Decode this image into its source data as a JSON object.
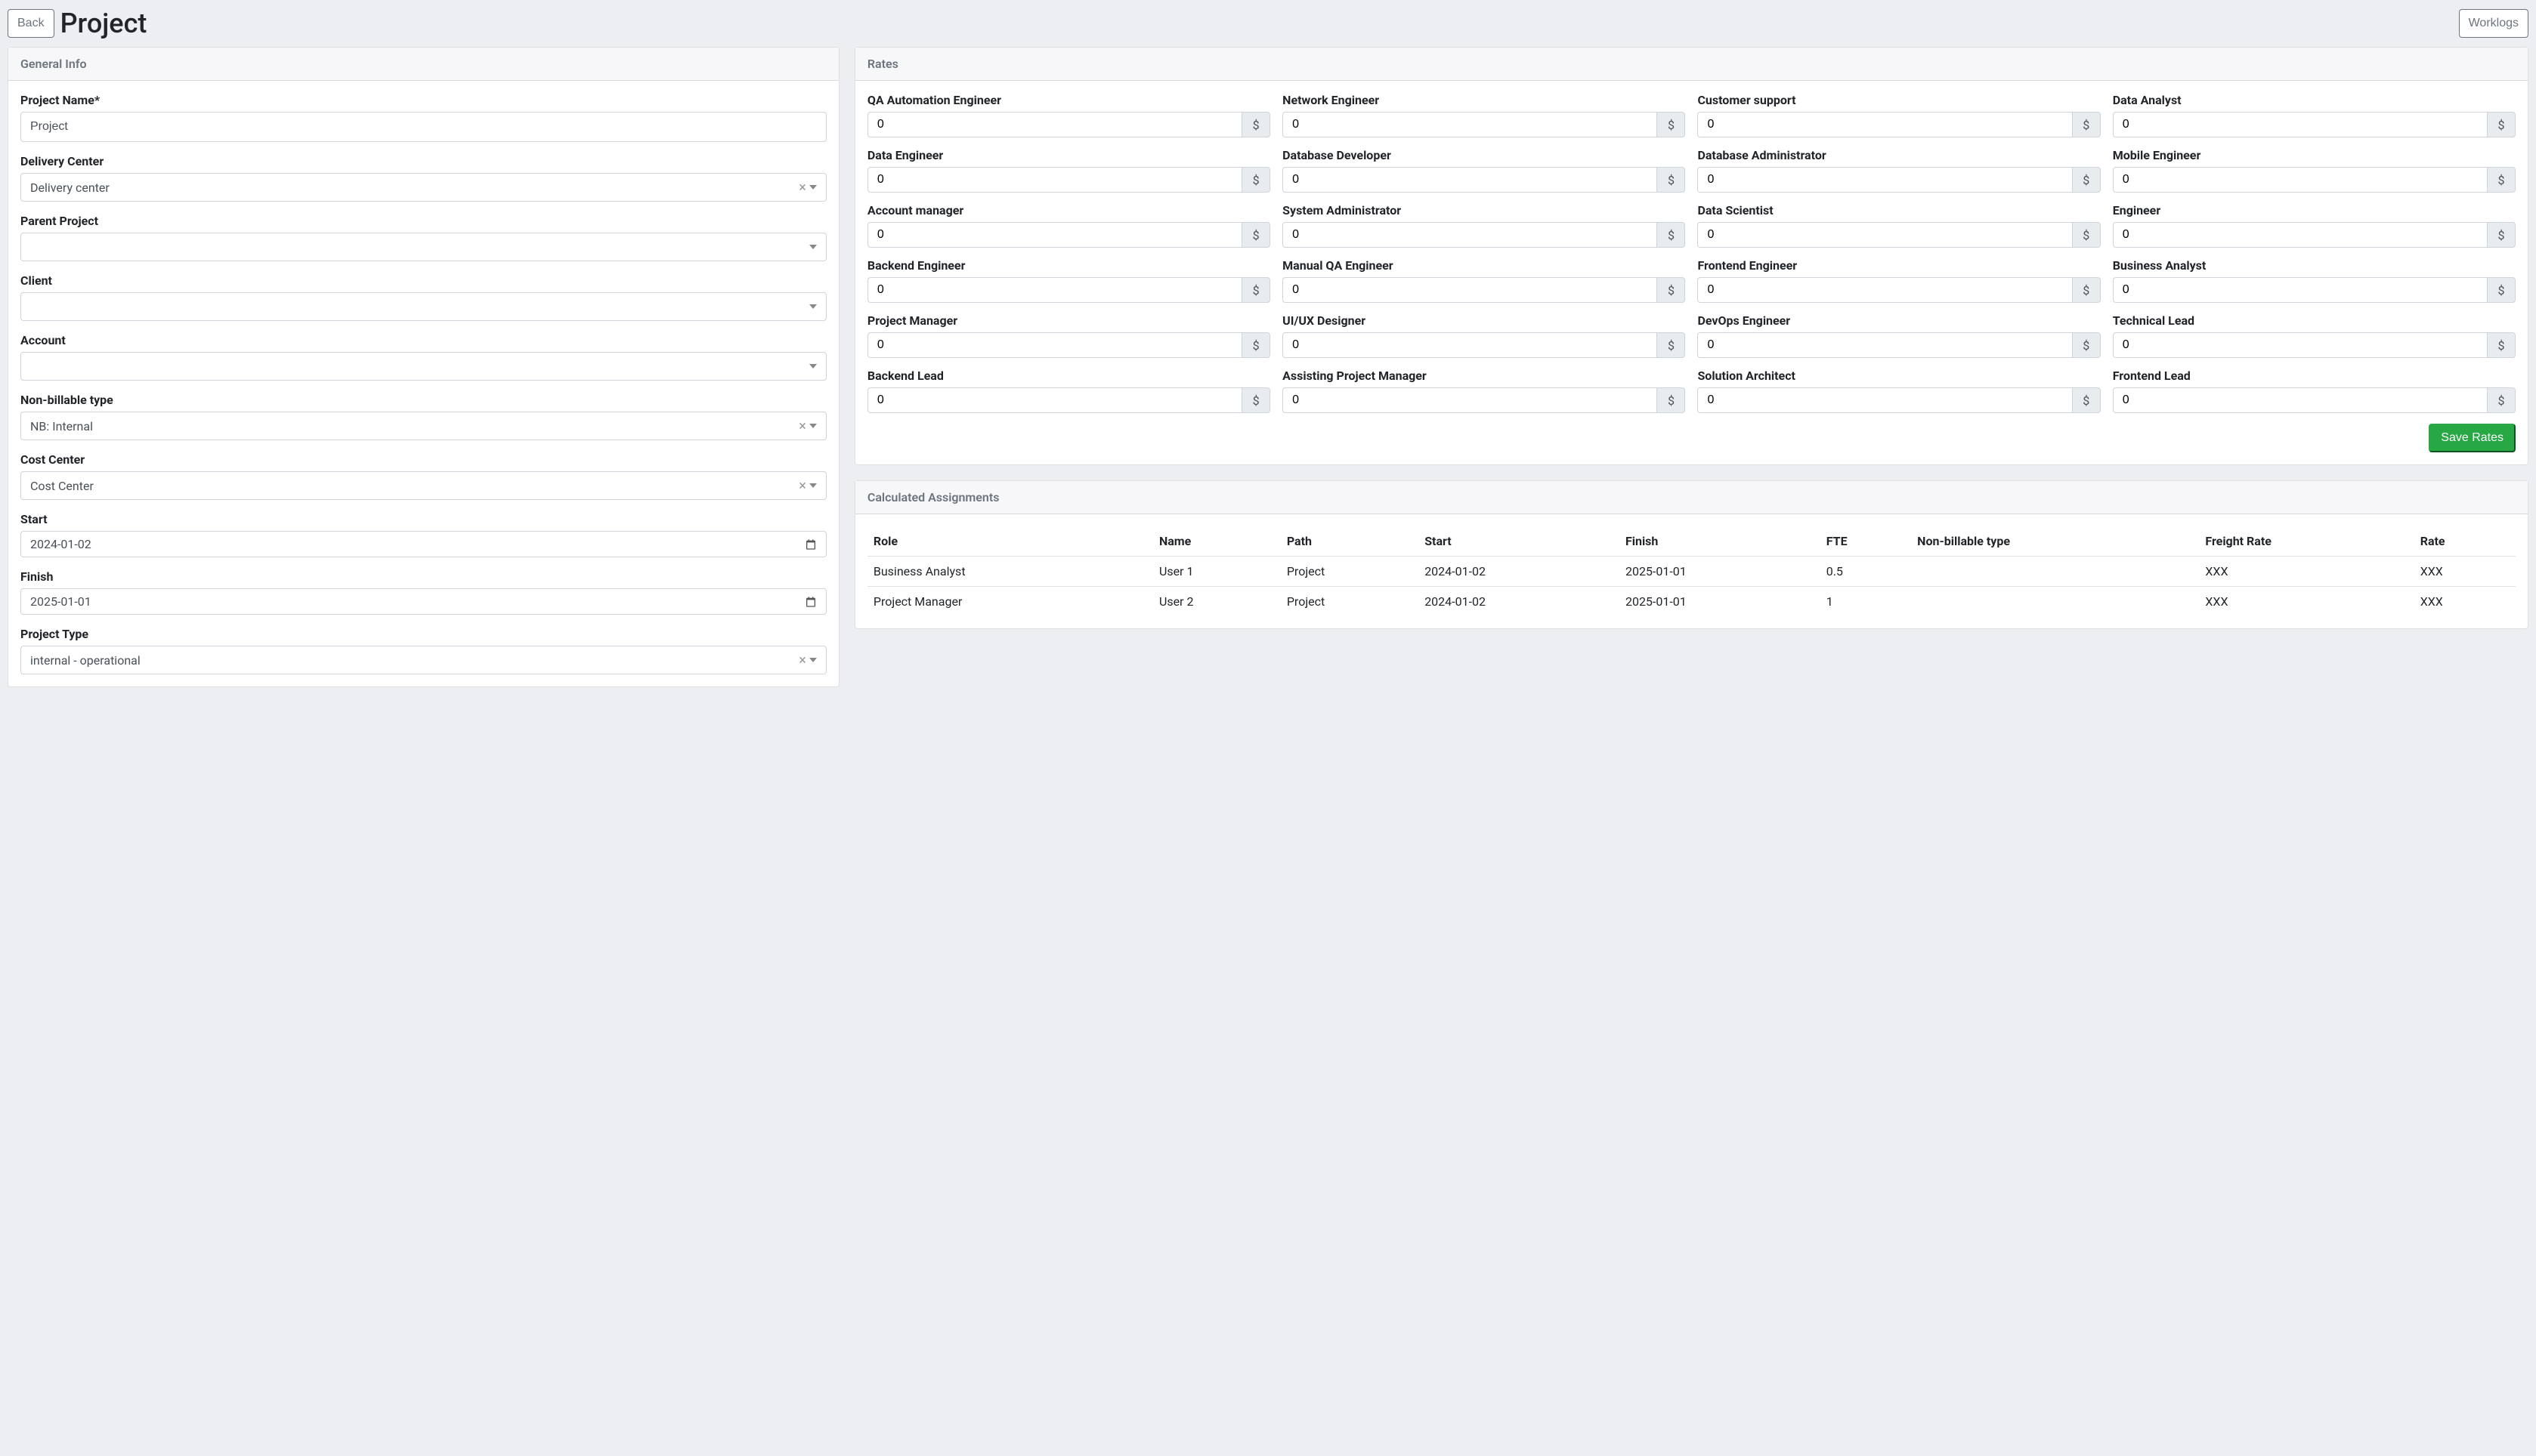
{
  "header": {
    "back_label": "Back",
    "title": "Project",
    "worklogs_label": "Worklogs"
  },
  "general_info": {
    "card_title": "General Info",
    "project_name_label": "Project Name*",
    "project_name_value": "Project",
    "delivery_center_label": "Delivery Center",
    "delivery_center_value": "Delivery center",
    "parent_project_label": "Parent Project",
    "parent_project_value": "",
    "client_label": "Client",
    "client_value": "",
    "account_label": "Account",
    "account_value": "",
    "non_billable_type_label": "Non-billable type",
    "non_billable_type_value": "NB: Internal",
    "cost_center_label": "Cost Center",
    "cost_center_value": "Cost Center",
    "start_label": "Start",
    "start_value": "2024-01-02",
    "finish_label": "Finish",
    "finish_value": "2025-01-01",
    "project_type_label": "Project Type",
    "project_type_value": "internal - operational"
  },
  "rates": {
    "card_title": "Rates",
    "currency_symbol": "$",
    "save_button": "Save Rates",
    "items": [
      {
        "label": "QA Automation Engineer",
        "value": "0"
      },
      {
        "label": "Network Engineer",
        "value": "0"
      },
      {
        "label": "Customer support",
        "value": "0"
      },
      {
        "label": "Data Analyst",
        "value": "0"
      },
      {
        "label": "Data Engineer",
        "value": "0"
      },
      {
        "label": "Database Developer",
        "value": "0"
      },
      {
        "label": "Database Administrator",
        "value": "0"
      },
      {
        "label": "Mobile Engineer",
        "value": "0"
      },
      {
        "label": "Account manager",
        "value": "0"
      },
      {
        "label": "System Administrator",
        "value": "0"
      },
      {
        "label": "Data Scientist",
        "value": "0"
      },
      {
        "label": "Engineer",
        "value": "0"
      },
      {
        "label": "Backend Engineer",
        "value": "0"
      },
      {
        "label": "Manual QA Engineer",
        "value": "0"
      },
      {
        "label": "Frontend Engineer",
        "value": "0"
      },
      {
        "label": "Business Analyst",
        "value": "0"
      },
      {
        "label": "Project Manager",
        "value": "0"
      },
      {
        "label": "UI/UX Designer",
        "value": "0"
      },
      {
        "label": "DevOps Engineer",
        "value": "0"
      },
      {
        "label": "Technical Lead",
        "value": "0"
      },
      {
        "label": "Backend Lead",
        "value": "0"
      },
      {
        "label": "Assisting Project Manager",
        "value": "0"
      },
      {
        "label": "Solution Architect",
        "value": "0"
      },
      {
        "label": "Frontend Lead",
        "value": "0"
      }
    ]
  },
  "assignments": {
    "card_title": "Calculated Assignments",
    "columns": [
      "Role",
      "Name",
      "Path",
      "Start",
      "Finish",
      "FTE",
      "Non-billable type",
      "Freight Rate",
      "Rate"
    ],
    "rows": [
      {
        "role": "Business Analyst",
        "name": "User 1",
        "path": "Project",
        "start": "2024-01-02",
        "finish": "2025-01-01",
        "fte": "0.5",
        "nbt": "",
        "freight_rate": "XXX",
        "rate": "XXX"
      },
      {
        "role": "Project Manager",
        "name": "User 2",
        "path": "Project",
        "start": "2024-01-02",
        "finish": "2025-01-01",
        "fte": "1",
        "nbt": "",
        "freight_rate": "XXX",
        "rate": "XXX"
      }
    ]
  }
}
